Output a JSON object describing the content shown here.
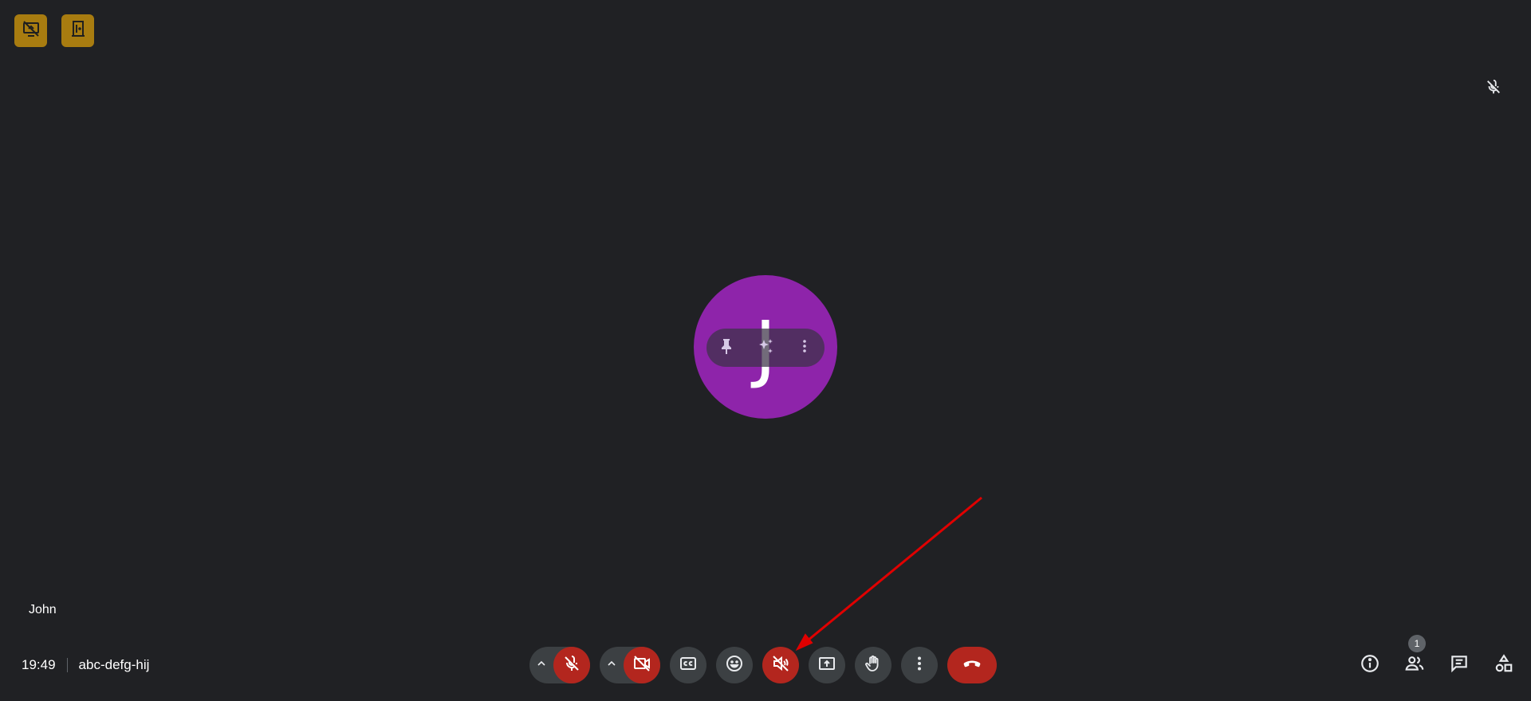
{
  "participant": {
    "name": "John",
    "initial": "J",
    "avatar_color": "#8e24aa"
  },
  "meeting": {
    "time": "19:49",
    "code": "abc-defg-hij"
  },
  "people": {
    "count": "1"
  },
  "colors": {
    "background": "#202124",
    "control": "#3c4043",
    "danger": "#b3261e",
    "host_badge": "#a87c10",
    "annotation": "#e00000"
  },
  "icons": {
    "host_badges": [
      "screen-share-off-icon",
      "exit-door-icon"
    ],
    "controls": [
      "chevron-up-icon",
      "mic-off-icon",
      "chevron-up-icon",
      "camera-off-icon",
      "closed-captions-icon",
      "emoji-icon",
      "speaker-off-icon",
      "present-screen-icon",
      "raise-hand-icon",
      "more-vert-icon",
      "call-end-icon"
    ],
    "right": [
      "info-icon",
      "people-icon",
      "chat-icon",
      "activities-icon"
    ],
    "tile": [
      "pin-icon",
      "sparkle-effects-icon",
      "more-vert-icon"
    ]
  }
}
